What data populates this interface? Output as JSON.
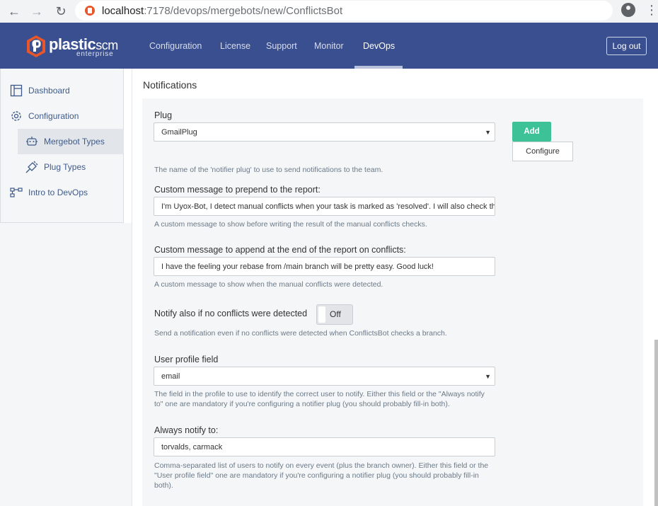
{
  "browser": {
    "url_host": "localhost",
    "url_path": ":7178/devops/mergebots/new/ConflictsBot"
  },
  "header": {
    "logo_word": "plastic",
    "logo_scm": "scm",
    "logo_sub": "enterprise",
    "nav": [
      "Configuration",
      "License",
      "Support",
      "Monitor",
      "DevOps"
    ],
    "logout_label": "Log out"
  },
  "sidebar": {
    "items": [
      "Dashboard",
      "Configuration",
      "Mergebot Types",
      "Plug Types",
      "Intro to DevOps"
    ]
  },
  "form": {
    "section_title": "Notifications",
    "plug": {
      "label": "Plug",
      "value": "GmailPlug",
      "help": "The name of the 'notifier plug' to use to send notifications to the team.",
      "add_label": "Add",
      "configure_label": "Configure"
    },
    "prepend": {
      "label": "Custom message to prepend to the report:",
      "value": "I'm Uyox-Bot, I detect manual conflicts when your task is marked as 'resolved'.  I will also check the whole branch",
      "help": "A custom message to show before writing the result of the manual conflicts checks."
    },
    "append": {
      "label": "Custom message to append at the end of the report on conflicts:",
      "value": "I have the feeling your rebase from /main branch will be pretty easy. Good luck!",
      "help": "A custom message to show when the manual conflicts were detected."
    },
    "notify_no_conflicts": {
      "label": "Notify also if no conflicts were detected",
      "state": "Off",
      "help": "Send a notification even if no conflicts were detected when ConflictsBot checks a branch."
    },
    "profile_field": {
      "label": "User profile field",
      "value": "email",
      "help": "The field in the profile to use to identify the correct user to notify. Either this field or the \"Always notify to\" one are mandatory if you're configuring a notifier plug (you should probably fill-in both)."
    },
    "always_notify": {
      "label": "Always notify to:",
      "value": "torvalds, carmack",
      "help": "Comma-separated list of users to notify on every event (plus the branch owner). Either this field or the \"User profile field\" one are mandatory if you're configuring a notifier plug (you should probably fill-in both)."
    }
  },
  "colors": {
    "header_bg": "#3a4f8f",
    "accent_green": "#3dc298",
    "sidebar_link": "#3f5a8a",
    "logo_orange": "#e8562a"
  }
}
